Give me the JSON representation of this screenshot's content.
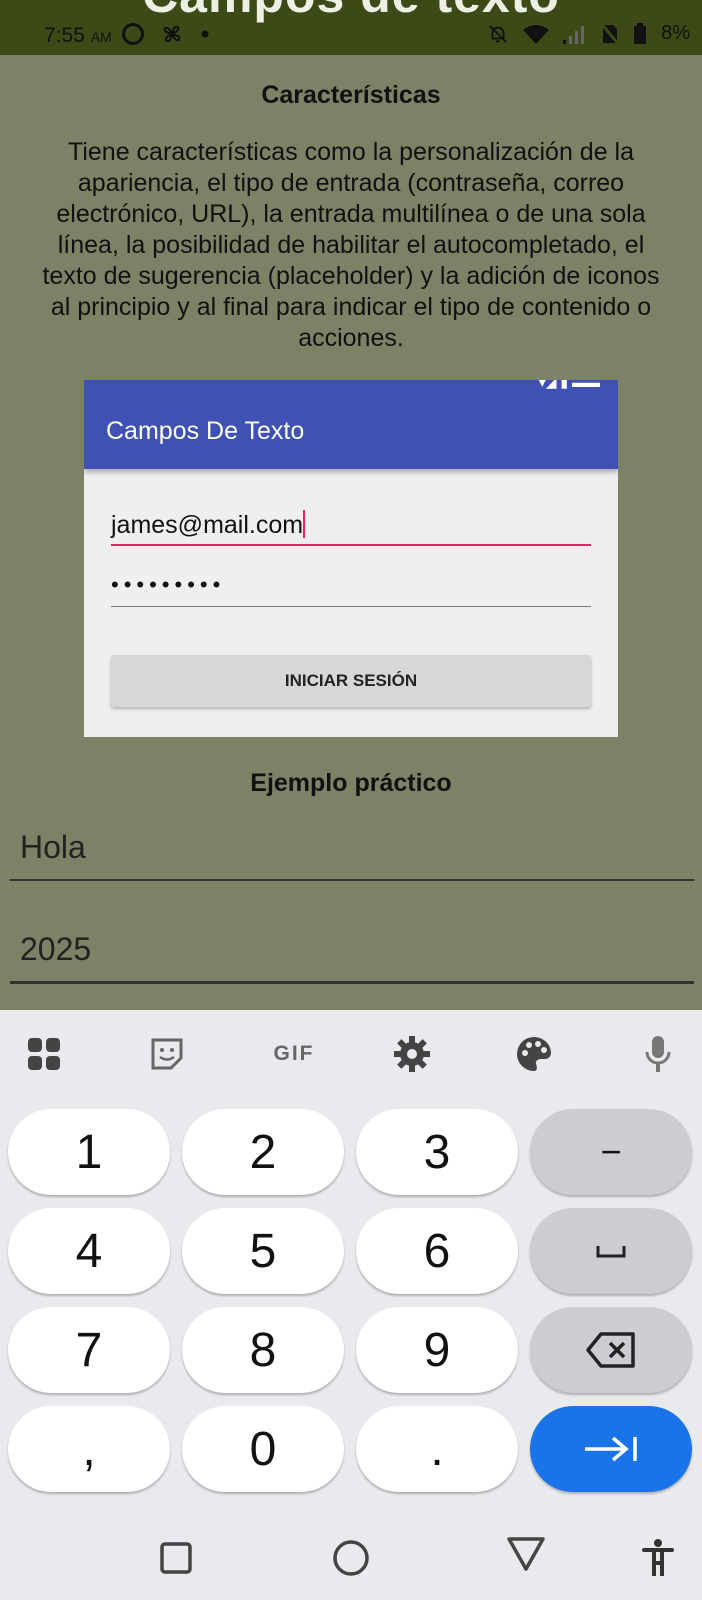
{
  "status_bar": {
    "cut_title": "Campos de texto",
    "time": "7:55",
    "ampm": "AM",
    "battery": "8%",
    "icons": [
      "no-entry-icon",
      "fan-icon",
      "dot-icon",
      "mute-bell-icon",
      "wifi-icon",
      "signal-icon",
      "no-sim-icon",
      "battery-icon"
    ]
  },
  "section1": {
    "heading": "Características",
    "paragraph": "Tiene características como la personalización de la apariencia, el tipo de entrada (contraseña, correo electrónico, URL), la entrada multilínea o de una sola línea, la posibilidad de habilitar el autocompletado, el texto de sugerencia (placeholder) y la adición de iconos al principio y al final para indicar el tipo de contenido o acciones."
  },
  "example_image": {
    "app_title": "Campos De Texto",
    "email_value": "james@mail.com",
    "password_value": "•••••••••",
    "button_label": "INICIAR SESIÓN",
    "accent_color": "#3f51b5",
    "focus_color": "#e91e63"
  },
  "section2": {
    "heading": "Ejemplo práctico",
    "field1_value": "Hola",
    "field2_value": "2025"
  },
  "keyboard": {
    "toolbar": [
      "apps-grid-icon",
      "sticker-icon",
      "gif-icon",
      "settings-gear-icon",
      "palette-icon",
      "microphone-icon"
    ],
    "gif_label": "GIF",
    "rows": [
      [
        "1",
        "2",
        "3",
        "−"
      ],
      [
        "4",
        "5",
        "6",
        "␣"
      ],
      [
        "7",
        "8",
        "9",
        "⌫"
      ],
      [
        ",",
        "0",
        ".",
        "→|"
      ]
    ],
    "enter_color": "#1a73e8"
  },
  "nav_bar": [
    "recent-apps-icon",
    "home-icon",
    "back-icon",
    "accessibility-icon"
  ]
}
